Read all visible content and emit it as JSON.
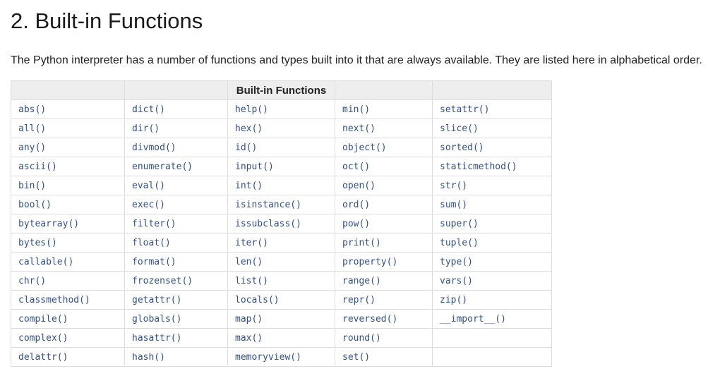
{
  "page": {
    "title": "2. Built-in Functions",
    "intro": "The Python interpreter has a number of functions and types built into it that are always available. They are listed here in alphabetical order."
  },
  "table": {
    "header": [
      "",
      "",
      "Built-in Functions",
      "",
      ""
    ],
    "rows": [
      [
        "abs()",
        "dict()",
        "help()",
        "min()",
        "setattr()"
      ],
      [
        "all()",
        "dir()",
        "hex()",
        "next()",
        "slice()"
      ],
      [
        "any()",
        "divmod()",
        "id()",
        "object()",
        "sorted()"
      ],
      [
        "ascii()",
        "enumerate()",
        "input()",
        "oct()",
        "staticmethod()"
      ],
      [
        "bin()",
        "eval()",
        "int()",
        "open()",
        "str()"
      ],
      [
        "bool()",
        "exec()",
        "isinstance()",
        "ord()",
        "sum()"
      ],
      [
        "bytearray()",
        "filter()",
        "issubclass()",
        "pow()",
        "super()"
      ],
      [
        "bytes()",
        "float()",
        "iter()",
        "print()",
        "tuple()"
      ],
      [
        "callable()",
        "format()",
        "len()",
        "property()",
        "type()"
      ],
      [
        "chr()",
        "frozenset()",
        "list()",
        "range()",
        "vars()"
      ],
      [
        "classmethod()",
        "getattr()",
        "locals()",
        "repr()",
        "zip()"
      ],
      [
        "compile()",
        "globals()",
        "map()",
        "reversed()",
        "__import__()"
      ],
      [
        "complex()",
        "hasattr()",
        "max()",
        "round()",
        ""
      ],
      [
        "delattr()",
        "hash()",
        "memoryview()",
        "set()",
        ""
      ]
    ]
  },
  "colors": {
    "link": "#30508c",
    "header_bg": "#eeeeee",
    "border": "#dddddd"
  }
}
